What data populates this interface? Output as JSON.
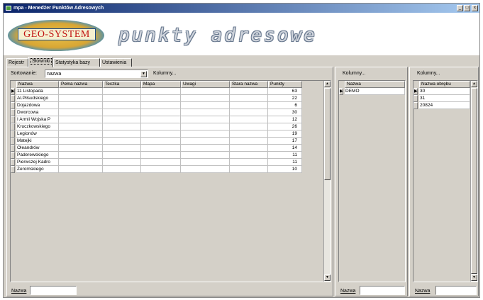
{
  "window": {
    "title": "mpa - Menedżer Punktów Adresowych",
    "minimize_glyph": "_",
    "maximize_glyph": "□",
    "close_glyph": "x"
  },
  "banner": {
    "logo_text": "GEO-SYSTEM",
    "heading": "punkty adresowe"
  },
  "tabs": [
    {
      "label": "Rejestr"
    },
    {
      "label": "Słowniki"
    },
    {
      "label": "Statystyka bazy"
    },
    {
      "label": "Ustawienia"
    }
  ],
  "left_panel": {
    "sort_label": "Sortowanie:",
    "sort_value": "nazwa",
    "columns_button": "Kolumny...",
    "columns": [
      "Nazwa",
      "Pełna nazwa",
      "Teczka",
      "Mapa",
      "Uwagi",
      "Stara nazwa",
      "Punkty"
    ],
    "rows": [
      {
        "nazwa": "11 Listopada",
        "punkty": "63"
      },
      {
        "nazwa": "Al.Piłsudskiego",
        "punkty": "22"
      },
      {
        "nazwa": "Dojazdowa",
        "punkty": "6"
      },
      {
        "nazwa": "Dworcowa",
        "punkty": "30"
      },
      {
        "nazwa": "I Armii Wojska P",
        "punkty": "12"
      },
      {
        "nazwa": "Kruczkowskiego",
        "punkty": "26"
      },
      {
        "nazwa": "Legionów",
        "punkty": "19"
      },
      {
        "nazwa": "Matejki",
        "punkty": "17"
      },
      {
        "nazwa": "Oleandrów",
        "punkty": "14"
      },
      {
        "nazwa": "Paderewskiego",
        "punkty": "11"
      },
      {
        "nazwa": "Pierwszej Kadro",
        "punkty": "11"
      },
      {
        "nazwa": "Żeromskiego",
        "punkty": "10"
      }
    ],
    "filter_label": "Nazwa",
    "filter_value": ""
  },
  "middle_panel": {
    "columns_button": "Kolumny...",
    "column": "Nazwa",
    "rows": [
      "DEMO"
    ],
    "filter_label": "Nazwa",
    "filter_value": ""
  },
  "right_panel": {
    "columns_button": "Kolumny...",
    "column": "Nazwa obrębu",
    "rows": [
      "30",
      "31",
      "20824"
    ],
    "filter_label": "Nazwa",
    "filter_value": ""
  }
}
